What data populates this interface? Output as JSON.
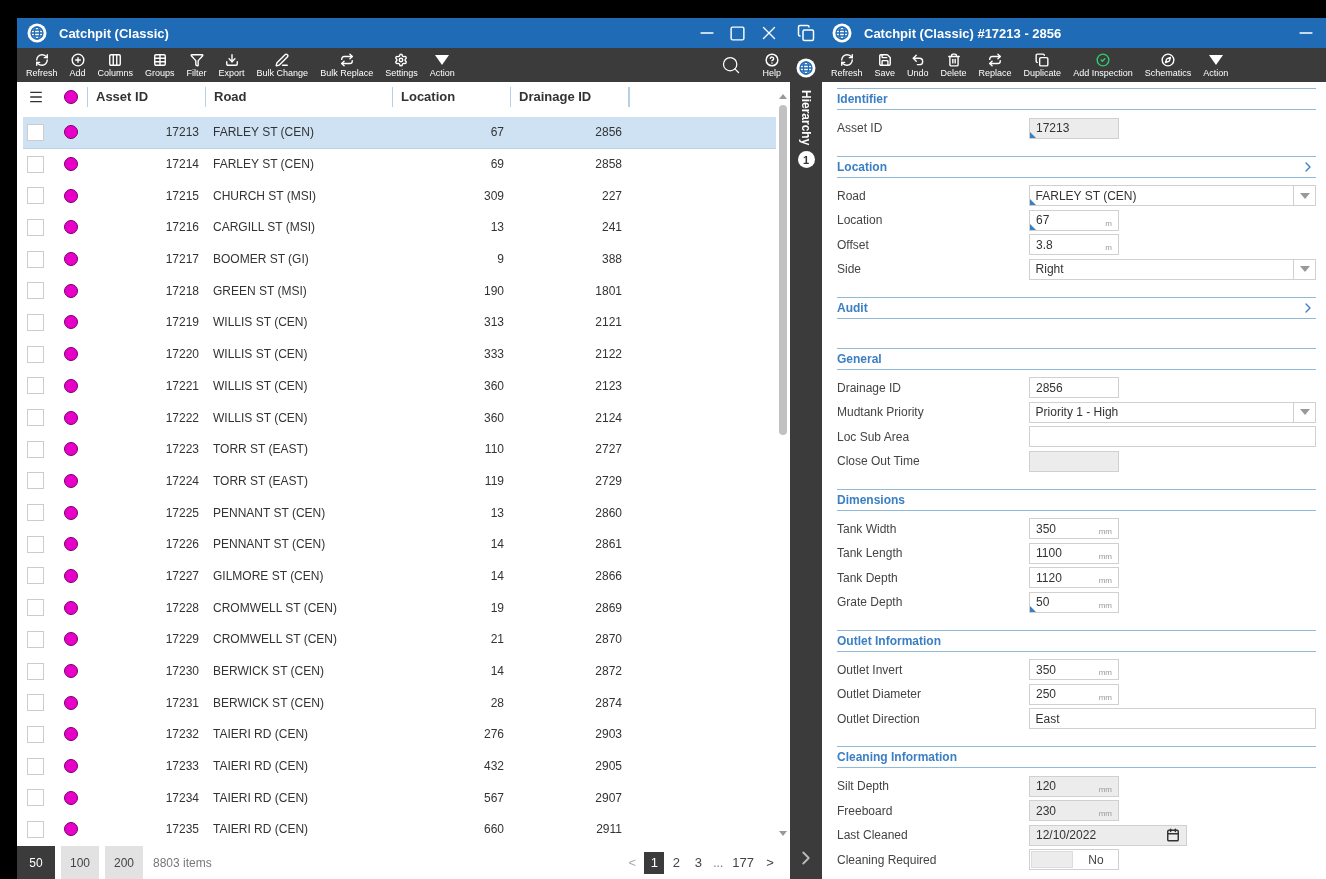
{
  "list_window": {
    "title": "Catchpit (Classic)",
    "toolbar": [
      {
        "kind": "refresh",
        "label": "Refresh"
      },
      {
        "kind": "add",
        "label": "Add"
      },
      {
        "kind": "columns",
        "label": "Columns"
      },
      {
        "kind": "groups",
        "label": "Groups"
      },
      {
        "kind": "filter",
        "label": "Filter"
      },
      {
        "kind": "export",
        "label": "Export"
      },
      {
        "kind": "bulk-change",
        "label": "Bulk Change"
      },
      {
        "kind": "bulk-replace",
        "label": "Bulk Replace"
      },
      {
        "kind": "settings",
        "label": "Settings"
      },
      {
        "kind": "action",
        "label": "Action"
      }
    ],
    "help_label": "Help",
    "table": {
      "columns": [
        "Asset ID",
        "Road",
        "Location",
        "Drainage ID"
      ],
      "rows": [
        {
          "asset_id": "17213",
          "road": "FARLEY ST (CEN)",
          "location": "67",
          "drainage_id": "2856",
          "selected": true,
          "checked": false
        },
        {
          "asset_id": "17214",
          "road": "FARLEY ST (CEN)",
          "location": "69",
          "drainage_id": "2858",
          "selected": false,
          "checked": false
        },
        {
          "asset_id": "17215",
          "road": "CHURCH ST (MSI)",
          "location": "309",
          "drainage_id": "227",
          "selected": false,
          "checked": false
        },
        {
          "asset_id": "17216",
          "road": "CARGILL ST (MSI)",
          "location": "13",
          "drainage_id": "241",
          "selected": false,
          "checked": false
        },
        {
          "asset_id": "17217",
          "road": "BOOMER ST (GI)",
          "location": "9",
          "drainage_id": "388",
          "selected": false,
          "checked": false
        },
        {
          "asset_id": "17218",
          "road": "GREEN ST (MSI)",
          "location": "190",
          "drainage_id": "1801",
          "selected": false,
          "checked": false
        },
        {
          "asset_id": "17219",
          "road": "WILLIS ST (CEN)",
          "location": "313",
          "drainage_id": "2121",
          "selected": false,
          "checked": false
        },
        {
          "asset_id": "17220",
          "road": "WILLIS ST (CEN)",
          "location": "333",
          "drainage_id": "2122",
          "selected": false,
          "checked": false
        },
        {
          "asset_id": "17221",
          "road": "WILLIS ST (CEN)",
          "location": "360",
          "drainage_id": "2123",
          "selected": false,
          "checked": false
        },
        {
          "asset_id": "17222",
          "road": "WILLIS ST (CEN)",
          "location": "360",
          "drainage_id": "2124",
          "selected": false,
          "checked": false
        },
        {
          "asset_id": "17223",
          "road": "TORR ST (EAST)",
          "location": "110",
          "drainage_id": "2727",
          "selected": false,
          "checked": false
        },
        {
          "asset_id": "17224",
          "road": "TORR ST (EAST)",
          "location": "119",
          "drainage_id": "2729",
          "selected": false,
          "checked": false
        },
        {
          "asset_id": "17225",
          "road": "PENNANT ST (CEN)",
          "location": "13",
          "drainage_id": "2860",
          "selected": false,
          "checked": false
        },
        {
          "asset_id": "17226",
          "road": "PENNANT ST (CEN)",
          "location": "14",
          "drainage_id": "2861",
          "selected": false,
          "checked": false
        },
        {
          "asset_id": "17227",
          "road": "GILMORE ST (CEN)",
          "location": "14",
          "drainage_id": "2866",
          "selected": false,
          "checked": false
        },
        {
          "asset_id": "17228",
          "road": "CROMWELL ST (CEN)",
          "location": "19",
          "drainage_id": "2869",
          "selected": false,
          "checked": false
        },
        {
          "asset_id": "17229",
          "road": "CROMWELL ST (CEN)",
          "location": "21",
          "drainage_id": "2870",
          "selected": false,
          "checked": false
        },
        {
          "asset_id": "17230",
          "road": "BERWICK ST (CEN)",
          "location": "14",
          "drainage_id": "2872",
          "selected": false,
          "checked": false
        },
        {
          "asset_id": "17231",
          "road": "BERWICK ST (CEN)",
          "location": "28",
          "drainage_id": "2874",
          "selected": false,
          "checked": false
        },
        {
          "asset_id": "17232",
          "road": "TAIERI RD (CEN)",
          "location": "276",
          "drainage_id": "2903",
          "selected": false,
          "checked": false
        },
        {
          "asset_id": "17233",
          "road": "TAIERI RD (CEN)",
          "location": "432",
          "drainage_id": "2905",
          "selected": false,
          "checked": false
        },
        {
          "asset_id": "17234",
          "road": "TAIERI RD (CEN)",
          "location": "567",
          "drainage_id": "2907",
          "selected": false,
          "checked": false
        },
        {
          "asset_id": "17235",
          "road": "TAIERI RD (CEN)",
          "location": "660",
          "drainage_id": "2911",
          "selected": false,
          "checked": false
        }
      ]
    },
    "page_sizes": [
      {
        "label": "50",
        "selected": true
      },
      {
        "label": "100",
        "selected": false
      },
      {
        "label": "200",
        "selected": false
      }
    ],
    "item_count": "8803 items",
    "pagination": [
      {
        "kind": "prev",
        "label": "<",
        "selected": false,
        "disabled": true
      },
      {
        "kind": "page",
        "label": "1",
        "selected": true,
        "disabled": false
      },
      {
        "kind": "page",
        "label": "2",
        "selected": false,
        "disabled": false
      },
      {
        "kind": "page",
        "label": "3",
        "selected": false,
        "disabled": false
      },
      {
        "kind": "gap",
        "label": "..."
      },
      {
        "kind": "page",
        "label": "177",
        "selected": false,
        "disabled": false
      },
      {
        "kind": "next",
        "label": ">",
        "selected": false,
        "disabled": false
      }
    ]
  },
  "side_strip": {
    "label": "Hierarchy",
    "badge": "1"
  },
  "detail_window": {
    "title": "Catchpit (Classic) #17213 - 2856",
    "toolbar": [
      {
        "kind": "refresh",
        "label": "Refresh"
      },
      {
        "kind": "save",
        "label": "Save"
      },
      {
        "kind": "undo",
        "label": "Undo"
      },
      {
        "kind": "delete",
        "label": "Delete"
      },
      {
        "kind": "replace",
        "label": "Replace"
      },
      {
        "kind": "duplicate",
        "label": "Duplicate"
      },
      {
        "kind": "add-inspection",
        "label": "Add Inspection"
      },
      {
        "kind": "schematics",
        "label": "Schematics"
      },
      {
        "kind": "action",
        "label": "Action"
      }
    ],
    "sections": [
      {
        "title": "Identifier",
        "chevron": false,
        "fields": [
          {
            "label": "Asset ID",
            "kind": "short",
            "value": "17213",
            "readonly": true,
            "required": true
          }
        ]
      },
      {
        "title": "Location",
        "chevron": true,
        "fields": [
          {
            "label": "Road",
            "kind": "select",
            "value": "FARLEY ST (CEN)",
            "readonly": false,
            "required": true
          },
          {
            "label": "Location",
            "kind": "short",
            "value": "67",
            "unit": "m",
            "readonly": false,
            "required": true
          },
          {
            "label": "Offset",
            "kind": "short",
            "value": "3.8",
            "unit": "m",
            "readonly": false,
            "required": false
          },
          {
            "label": "Side",
            "kind": "select",
            "value": "Right",
            "readonly": false,
            "required": false
          }
        ]
      },
      {
        "title": "Audit",
        "chevron": true
      },
      {
        "title": "General",
        "chevron": false,
        "fields": [
          {
            "label": "Drainage ID",
            "kind": "short",
            "value": "2856",
            "readonly": false,
            "required": false
          },
          {
            "label": "Mudtank Priority",
            "kind": "select",
            "value": "Priority 1 - High",
            "readonly": false,
            "required": false
          },
          {
            "label": "Loc Sub Area",
            "kind": "wide",
            "readonly": false,
            "required": false
          },
          {
            "label": "Close Out Time",
            "kind": "short",
            "readonly": true,
            "required": false
          }
        ]
      },
      {
        "title": "Dimensions",
        "chevron": false,
        "fields": [
          {
            "label": "Tank Width",
            "kind": "short",
            "value": "350",
            "unit": "mm",
            "readonly": false,
            "required": false
          },
          {
            "label": "Tank Length",
            "kind": "short",
            "value": "1100",
            "unit": "mm",
            "readonly": false,
            "required": false
          },
          {
            "label": "Tank Depth",
            "kind": "short",
            "value": "1120",
            "unit": "mm",
            "readonly": false,
            "required": false
          },
          {
            "label": "Grate Depth",
            "kind": "short",
            "value": "50",
            "unit": "mm",
            "readonly": false,
            "required": true
          }
        ]
      },
      {
        "title": "Outlet Information",
        "chevron": false,
        "fields": [
          {
            "label": "Outlet Invert",
            "kind": "short",
            "value": "350",
            "unit": "mm",
            "readonly": false,
            "required": false
          },
          {
            "label": "Outlet Diameter",
            "kind": "short",
            "value": "250",
            "unit": "mm",
            "readonly": false,
            "required": false
          },
          {
            "label": "Outlet Direction",
            "kind": "wide",
            "value": "East",
            "readonly": false,
            "required": false
          }
        ]
      },
      {
        "title": "Cleaning Information",
        "chevron": false,
        "fields": [
          {
            "label": "Silt Depth",
            "kind": "short",
            "value": "120",
            "unit": "mm",
            "readonly": true,
            "required": false
          },
          {
            "label": "Freeboard",
            "kind": "short",
            "value": "230",
            "unit": "mm",
            "readonly": true,
            "required": false
          },
          {
            "label": "Last Cleaned",
            "kind": "date",
            "value": "12/10/2022",
            "readonly": true,
            "required": false
          },
          {
            "label": "Cleaning Required",
            "kind": "toggle",
            "value": "No",
            "on": false,
            "readonly": false,
            "required": false
          }
        ]
      }
    ]
  }
}
